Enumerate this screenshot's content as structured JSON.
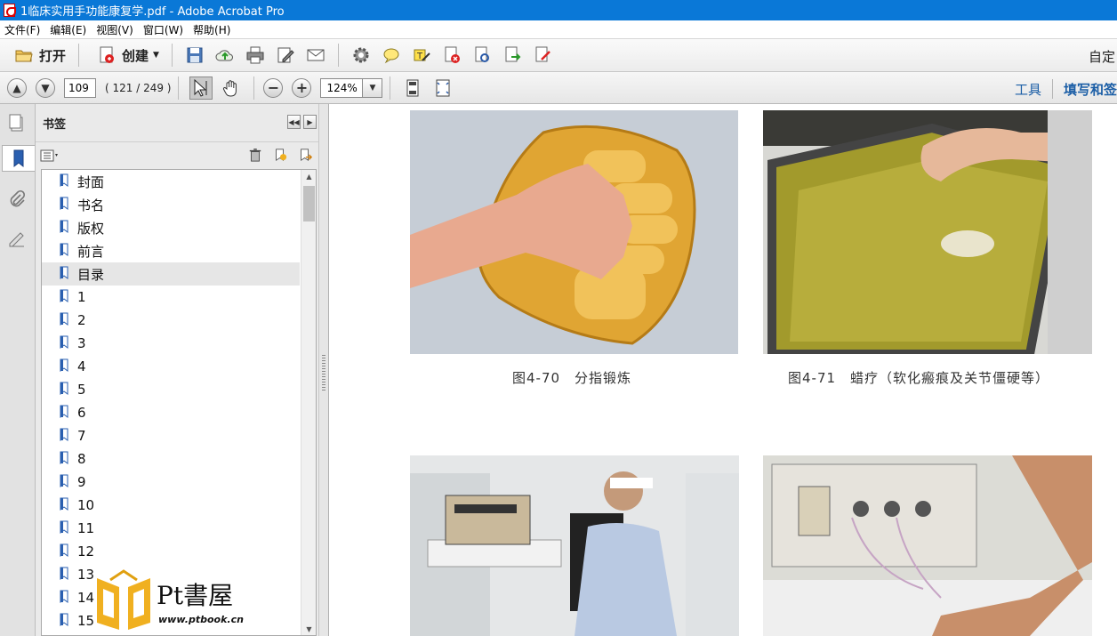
{
  "window": {
    "title": "1临床实用手功能康复学.pdf - Adobe Acrobat Pro"
  },
  "menu": [
    "文件(F)",
    "编辑(E)",
    "视图(V)",
    "窗口(W)",
    "帮助(H)"
  ],
  "toolbar": {
    "open_label": "打开",
    "create_label": "创建",
    "customize_label": "自定"
  },
  "navigation": {
    "page_number": "109",
    "page_count": "( 121 / 249 )",
    "zoom": "124%",
    "tools_label": "工具",
    "fill_sign_label": "填写和签"
  },
  "bookmarks": {
    "title": "书签",
    "items": [
      "封面",
      "书名",
      "版权",
      "前言",
      "目录",
      "1",
      "2",
      "3",
      "4",
      "5",
      "6",
      "7",
      "8",
      "9",
      "10",
      "11",
      "12",
      "13",
      "14",
      "15"
    ],
    "selected_index": 4
  },
  "document": {
    "captions": [
      "图4-70　分指锻炼",
      "图4-71　蜡疗（软化瘢痕及关节僵硬等）"
    ]
  },
  "watermark": {
    "brand": "Pt書屋",
    "url": "www.ptbook.cn"
  }
}
